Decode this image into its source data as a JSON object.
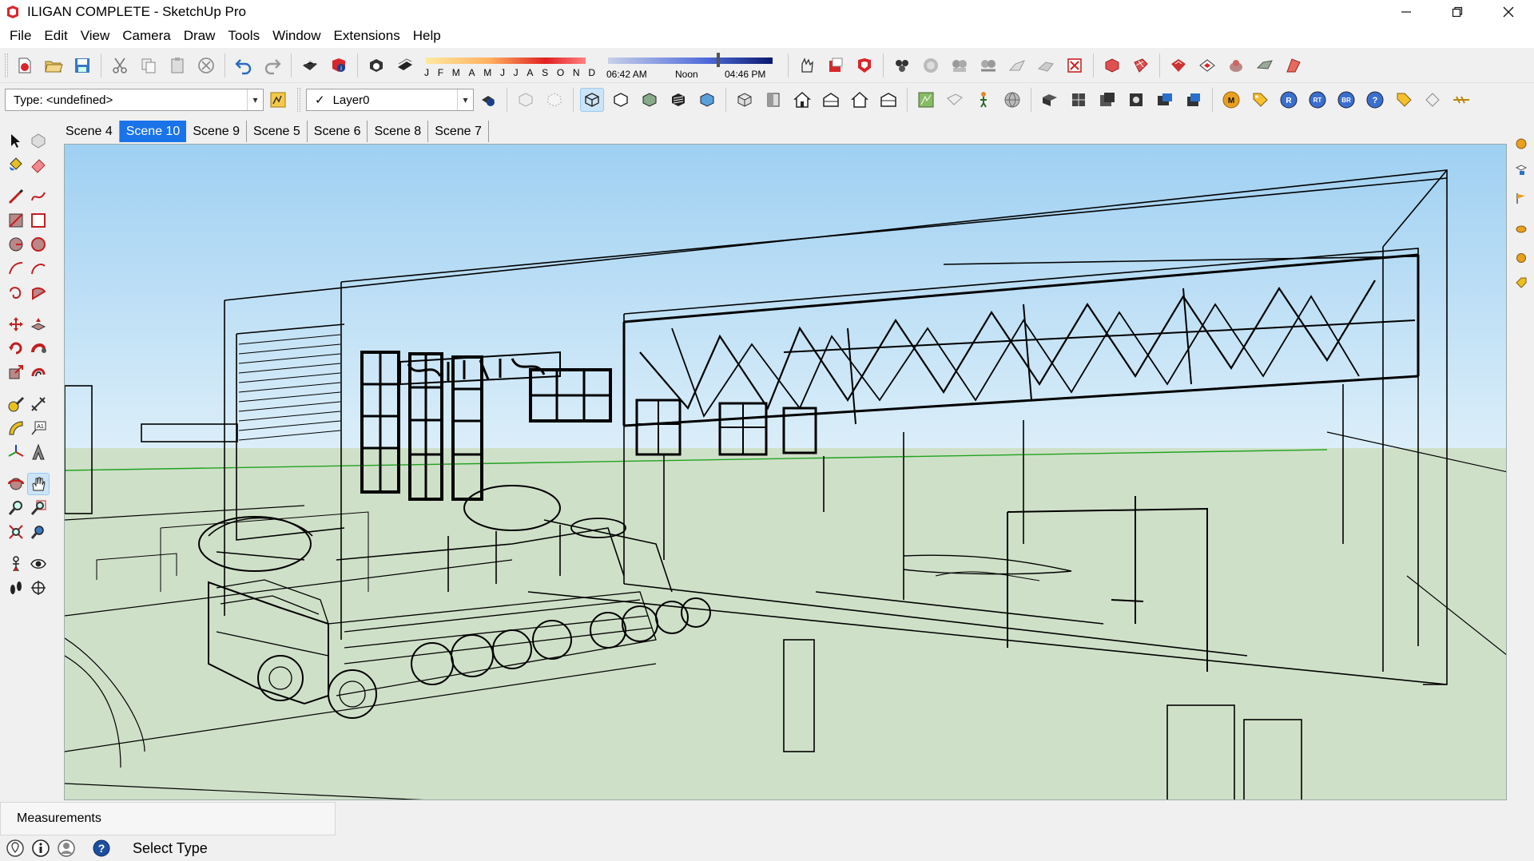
{
  "window": {
    "title": "ILIGAN COMPLETE - SketchUp Pro",
    "minimize_icon": "minimize-icon",
    "maximize_icon": "restore-icon",
    "close_icon": "close-icon"
  },
  "menu": [
    "File",
    "Edit",
    "View",
    "Camera",
    "Draw",
    "Tools",
    "Window",
    "Extensions",
    "Help"
  ],
  "shadows": {
    "months": [
      "J",
      "F",
      "M",
      "A",
      "M",
      "J",
      "J",
      "A",
      "S",
      "O",
      "N",
      "D"
    ],
    "time_start": "06:42 AM",
    "time_mid": "Noon",
    "time_end": "04:46 PM"
  },
  "entity_info": {
    "type_value": "Type: <undefined>"
  },
  "layers": {
    "current": "Layer0",
    "checked": "✓"
  },
  "scenes": {
    "tabs": [
      "Scene 4",
      "Scene 10",
      "Scene 9",
      "Scene 5",
      "Scene 6",
      "Scene 8",
      "Scene 7"
    ],
    "active_index": 1
  },
  "extension_badges": [
    "M",
    "R",
    "RT",
    "BR",
    "?"
  ],
  "measurements": {
    "label": "Measurements"
  },
  "status": {
    "text": "Select Type",
    "help_glyph": "?"
  },
  "colors": {
    "sky_top": "#9fd0f2",
    "sky_bottom": "#dbeef9",
    "ground": "#cfe0c8",
    "active_tab": "#1a73e8",
    "green_axis": "#1fa31f"
  }
}
